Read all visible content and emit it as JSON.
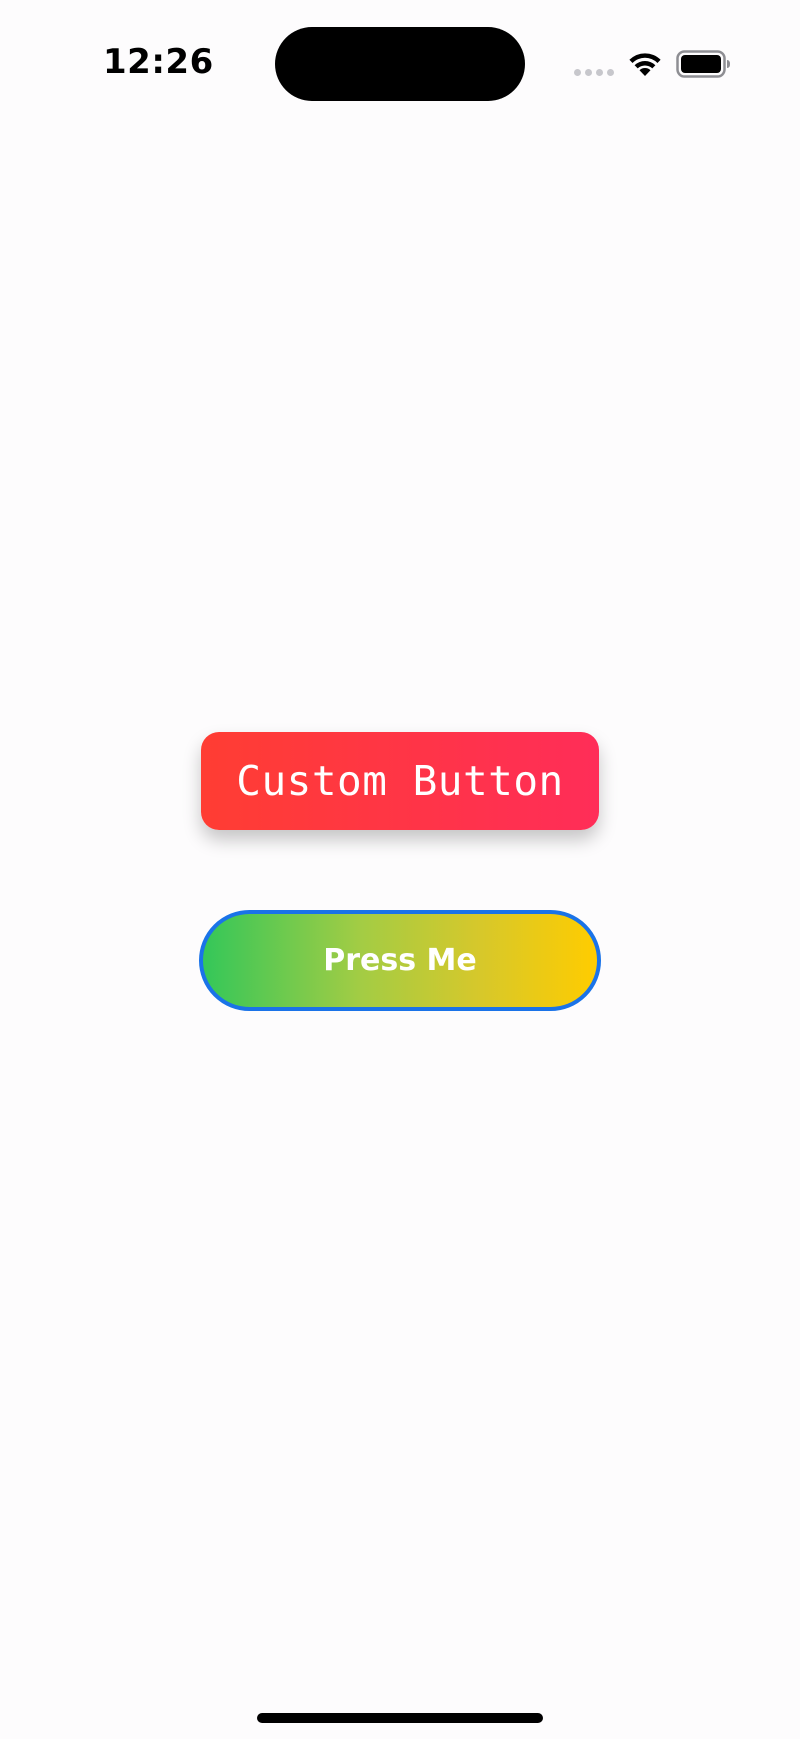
{
  "status_bar": {
    "time": "12:26",
    "icons": [
      "signal-dots-icon",
      "wifi-icon",
      "battery-icon"
    ]
  },
  "buttons": {
    "custom": {
      "label": "Custom Button",
      "gradient": [
        "#ff3d33",
        "#ff2d58"
      ]
    },
    "press": {
      "label": "Press Me",
      "gradient": [
        "#34c759",
        "#ffcc00"
      ],
      "border_color": "#1a73e8"
    }
  },
  "colors": {
    "background": "#fdfcfd",
    "text_on_button": "#ffffff"
  }
}
